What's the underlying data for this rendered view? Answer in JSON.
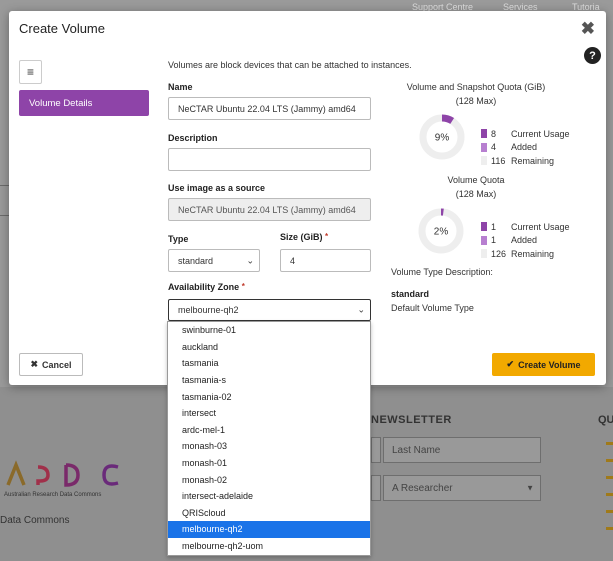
{
  "background": {
    "top_nav": [
      "Support Centre",
      "Services",
      "Tutoria"
    ],
    "newsletter_heading": "NEWSLETTER",
    "quick_heading": "QU",
    "first_name_placeholder": "",
    "last_name_placeholder": "Last Name",
    "role_select_value": "A Researcher",
    "logo_caption": "Australian Research Data Commons",
    "commons_text": "Data Commons"
  },
  "modal": {
    "title": "Create Volume",
    "close_glyph": "✖",
    "help_glyph": "?",
    "menu_glyph": "≡",
    "nav": [
      {
        "label": "Volume Details",
        "active": true
      }
    ],
    "intro": "Volumes are block devices that can be attached to instances.",
    "form": {
      "name_label": "Name",
      "name_value": "NeCTAR Ubuntu 22.04 LTS (Jammy) amd64",
      "description_label": "Description",
      "description_value": "",
      "image_source_label": "Use image as a source",
      "image_source_value": "NeCTAR Ubuntu 22.04 LTS (Jammy) amd64",
      "type_label": "Type",
      "type_value": "standard",
      "size_label": "Size (GiB)",
      "size_value": "4",
      "az_label": "Availability Zone",
      "az_value": "melbourne-qh2",
      "required_mark": "*"
    },
    "az_options": [
      "swinburne-01",
      "auckland",
      "tasmania",
      "tasmania-s",
      "tasmania-02",
      "intersect",
      "ardc-mel-1",
      "monash-03",
      "monash-01",
      "monash-02",
      "intersect-adelaide",
      "QRIScloud",
      "melbourne-qh2",
      "melbourne-qh2-uom"
    ],
    "az_selected_index": 12,
    "quota": {
      "snapshot_title": "Volume and Snapshot Quota (GiB)",
      "snapshot_max": "(128 Max)",
      "snapshot_percent": "9%",
      "snapshot_percent_value": 9,
      "snapshot_legend": [
        {
          "value": "8",
          "label": "Current Usage",
          "color": "#8e44a8"
        },
        {
          "value": "4",
          "label": "Added",
          "color": "#b77fd0"
        },
        {
          "value": "116",
          "label": "Remaining",
          "color": "#eeeeee"
        }
      ],
      "volume_title": "Volume Quota",
      "volume_max": "(128 Max)",
      "volume_percent": "2%",
      "volume_percent_value": 2,
      "volume_legend": [
        {
          "value": "1",
          "label": "Current Usage",
          "color": "#8e44a8"
        },
        {
          "value": "1",
          "label": "Added",
          "color": "#b77fd0"
        },
        {
          "value": "126",
          "label": "Remaining",
          "color": "#eeeeee"
        }
      ]
    },
    "volume_type_desc_label": "Volume Type Description:",
    "volume_type_name": "standard",
    "volume_type_default": "Default Volume Type",
    "cancel_label": "Cancel",
    "cancel_glyph": "✖",
    "create_label": "Create Volume",
    "create_glyph": "✔"
  }
}
